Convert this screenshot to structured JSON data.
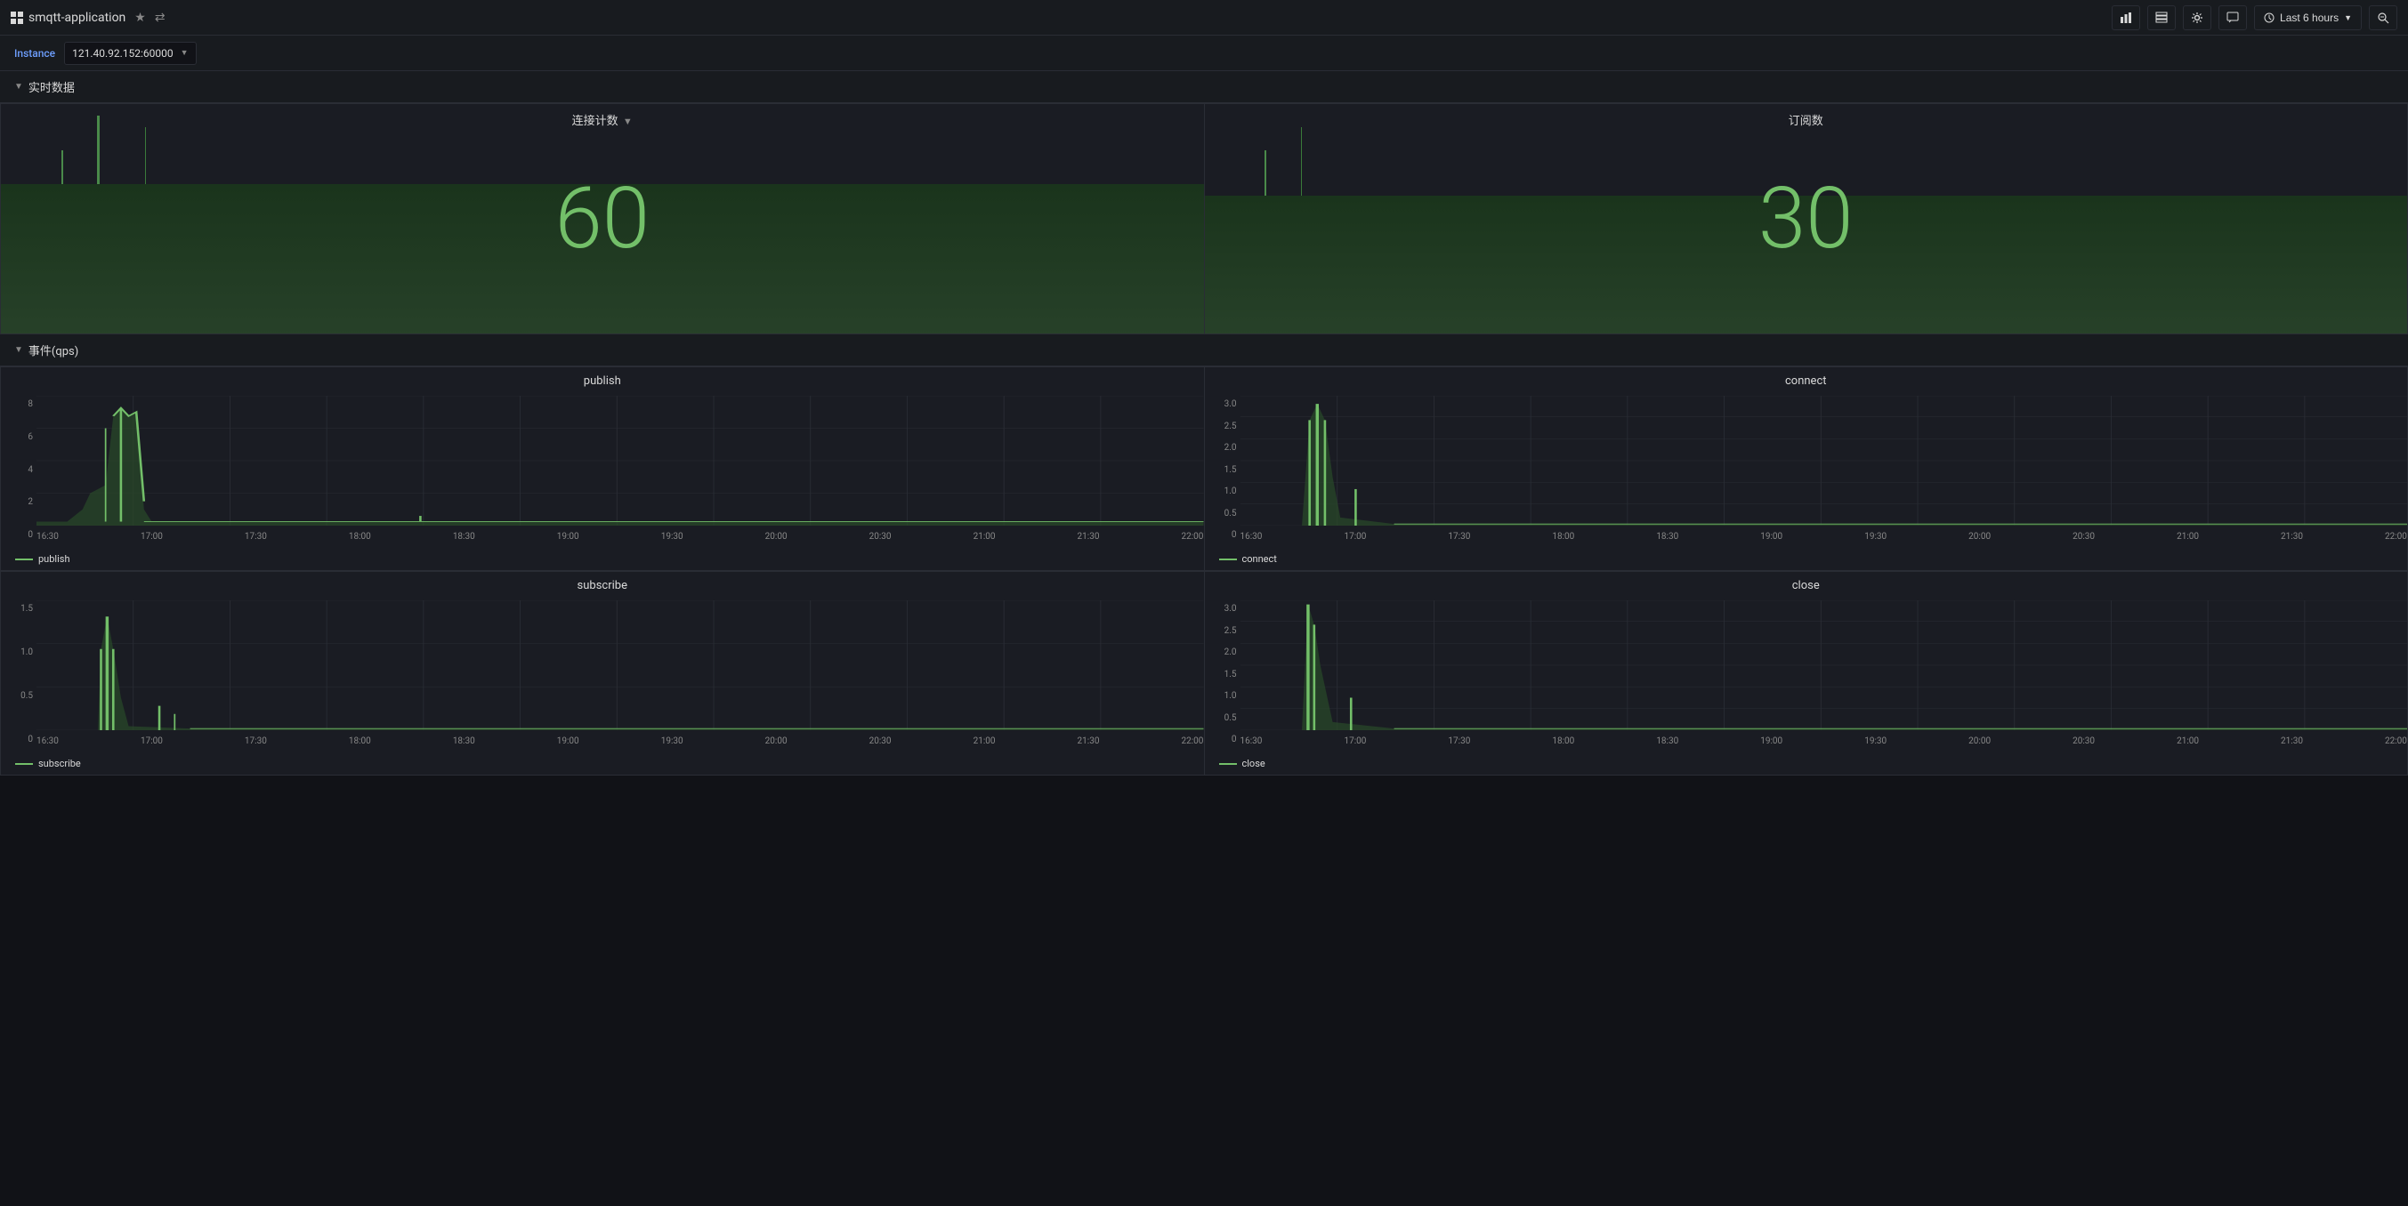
{
  "header": {
    "app_icon": "grid-icon",
    "app_title": "smqtt-application",
    "star_label": "★",
    "share_label": "⇄"
  },
  "toolbar": {
    "graph_icon": "📊",
    "table_icon": "📋",
    "settings_icon": "⚙",
    "comment_icon": "💬",
    "time_range": "Last 6 hours",
    "zoom_icon": "🔍"
  },
  "filter": {
    "label": "Instance",
    "value": "121.40.92.152:60000",
    "dropdown_arrow": "▼"
  },
  "sections": {
    "realtime": "实时数据",
    "events": "事件(qps)"
  },
  "panels": {
    "connections": {
      "title": "连接计数",
      "title_arrow": "▼",
      "value": "60"
    },
    "subscriptions": {
      "title": "订阅数",
      "value": "30"
    },
    "publish": {
      "title": "publish",
      "y_axis": [
        "8",
        "6",
        "4",
        "2",
        "0"
      ],
      "x_axis": [
        "16:30",
        "17:00",
        "17:30",
        "18:00",
        "18:30",
        "19:00",
        "19:30",
        "20:00",
        "20:30",
        "21:00",
        "21:30",
        "22:00"
      ],
      "legend": "publish"
    },
    "connect": {
      "title": "connect",
      "y_axis": [
        "3.0",
        "2.5",
        "2.0",
        "1.5",
        "1.0",
        "0.5",
        "0"
      ],
      "x_axis": [
        "16:30",
        "17:00",
        "17:30",
        "18:00",
        "18:30",
        "19:00",
        "19:30",
        "20:00",
        "20:30",
        "21:00",
        "21:30",
        "22:00"
      ],
      "legend": "connect"
    },
    "subscribe": {
      "title": "subscribe",
      "y_axis": [
        "1.5",
        "1.0",
        "0.5",
        "0"
      ],
      "x_axis": [
        "16:30",
        "17:00",
        "17:30",
        "18:00",
        "18:30",
        "19:00",
        "19:30",
        "20:00",
        "20:30",
        "21:00",
        "21:30",
        "22:00"
      ],
      "legend": "subscribe"
    },
    "close": {
      "title": "close",
      "y_axis": [
        "3.0",
        "2.5",
        "2.0",
        "1.5",
        "1.0",
        "0.5",
        "0"
      ],
      "x_axis": [
        "16:30",
        "17:00",
        "17:30",
        "18:00",
        "18:30",
        "19:00",
        "19:30",
        "20:00",
        "20:30",
        "21:00",
        "21:30",
        "22:00"
      ],
      "legend": "close"
    }
  },
  "colors": {
    "bg_dark": "#111217",
    "bg_panel": "#1a1c23",
    "bg_header": "#181b1f",
    "border": "#2a2d35",
    "green_bright": "#73bf69",
    "green_dark": "#2a4a2a",
    "text_muted": "#888888",
    "text_primary": "#d9d9d9",
    "accent_blue": "#6e9fff"
  }
}
